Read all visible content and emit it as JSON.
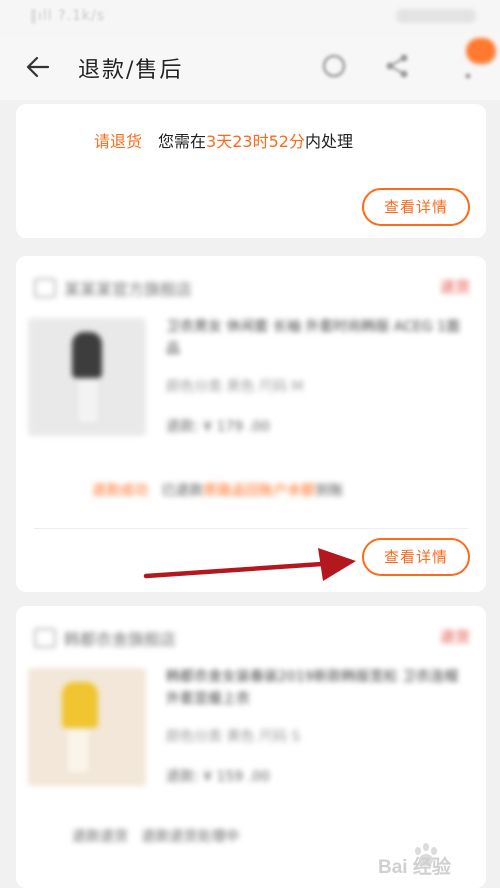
{
  "status_bar": {
    "text": "‖ıll ?.1k/s"
  },
  "header": {
    "title": "退款/售后"
  },
  "icons": {
    "back": "back-arrow-icon",
    "service": "customer-service-icon",
    "share": "share-icon",
    "more": "more-icon"
  },
  "order1": {
    "status_label": "请退货",
    "prefix": "您需在",
    "days": "3天",
    "hours": "23时",
    "minutes": "52分",
    "suffix": "内处理",
    "detail_button": "查看详情"
  },
  "order2": {
    "shop_name": "某某某官方旗舰店",
    "status_tag": "退货",
    "product_title": "卫衣男女 休闲套 长袖 外套时尚韩版 ACEG 1面品",
    "product_spec": "颜色分类 黑色 尺码 M",
    "product_price": "退款: ¥ 179 .00",
    "refund_label": "退款成功",
    "refund_text_a": "已退款",
    "refund_text_b": "原路返回账户余额",
    "refund_text_c": "到账",
    "detail_button": "查看详情"
  },
  "order3": {
    "shop_name": "韩都衣舍旗舰店",
    "status_tag": "退货",
    "product_title": "韩都衣舍女装春装2019新款韩版宽松 卫衣连帽外套显瘦上衣",
    "product_spec": "颜色分类 黄色 尺码 S",
    "product_price": "退款: ¥ 159 .00",
    "extra_text_a": "退款退货",
    "extra_text_b": "退款退货处理中"
  },
  "watermark": {
    "text": "Bai 经验"
  },
  "colors": {
    "accent": "#ff6a1a",
    "arrow": "#b3181e"
  }
}
